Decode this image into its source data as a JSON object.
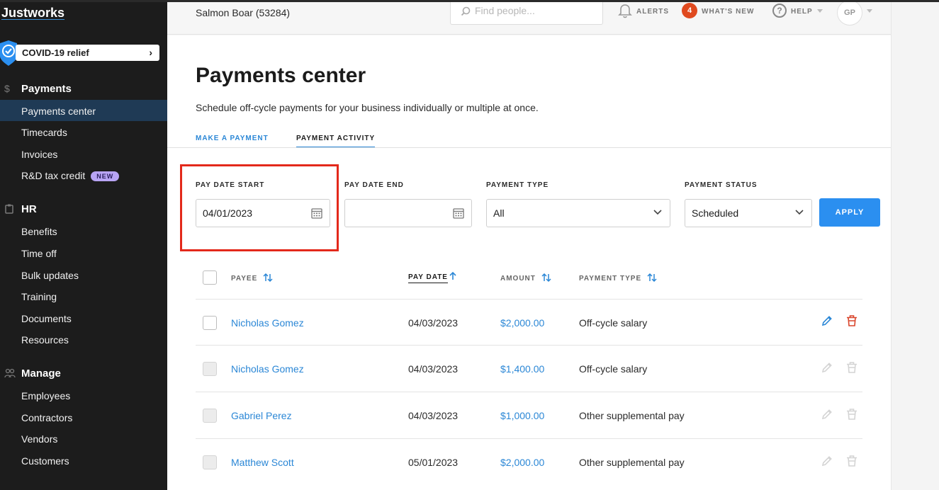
{
  "sidebar": {
    "logo": "Justworks",
    "covid_label": "COVID-19 relief",
    "sections": [
      {
        "title": "Payments",
        "items": [
          {
            "label": "Payments center"
          },
          {
            "label": "Timecards"
          },
          {
            "label": "Invoices"
          },
          {
            "label": "R&D tax credit",
            "badge": "NEW"
          }
        ]
      },
      {
        "title": "HR",
        "items": [
          {
            "label": "Benefits"
          },
          {
            "label": "Time off"
          },
          {
            "label": "Bulk updates"
          },
          {
            "label": "Training"
          },
          {
            "label": "Documents"
          },
          {
            "label": "Resources"
          }
        ]
      },
      {
        "title": "Manage",
        "items": [
          {
            "label": "Employees"
          },
          {
            "label": "Contractors"
          },
          {
            "label": "Vendors"
          },
          {
            "label": "Customers"
          }
        ]
      }
    ]
  },
  "topbar": {
    "company": "Salmon Boar (53284)",
    "search_placeholder": "Find people...",
    "alerts_label": "ALERTS",
    "notification_count": "4",
    "whats_new_label": "WHAT'S NEW",
    "help_label": "HELP",
    "avatar_initials": "GP"
  },
  "main": {
    "title": "Payments center",
    "subtitle": "Schedule off-cycle payments for your business individually or multiple at once.",
    "tabs": [
      {
        "label": "MAKE A PAYMENT",
        "active": false
      },
      {
        "label": "PAYMENT ACTIVITY",
        "active": true
      }
    ],
    "filters": {
      "pay_date_start": {
        "label": "PAY DATE START",
        "value": "04/01/2023"
      },
      "pay_date_end": {
        "label": "PAY DATE END",
        "value": ""
      },
      "payment_type": {
        "label": "PAYMENT TYPE",
        "value": "All"
      },
      "payment_status": {
        "label": "PAYMENT STATUS",
        "value": "Scheduled"
      },
      "apply_label": "APPLY"
    },
    "table": {
      "headers": [
        "PAYEE",
        "PAY DATE",
        "AMOUNT",
        "PAYMENT TYPE"
      ],
      "rows": [
        {
          "payee": "Nicholas Gomez",
          "pay_date": "04/03/2023",
          "amount": "$2,000.00",
          "type": "Off-cycle salary",
          "editable": true
        },
        {
          "payee": "Nicholas Gomez",
          "pay_date": "04/03/2023",
          "amount": "$1,400.00",
          "type": "Off-cycle salary",
          "editable": false
        },
        {
          "payee": "Gabriel Perez",
          "pay_date": "04/03/2023",
          "amount": "$1,000.00",
          "type": "Other supplemental pay",
          "editable": false
        },
        {
          "payee": "Matthew Scott",
          "pay_date": "05/01/2023",
          "amount": "$2,000.00",
          "type": "Other supplemental pay",
          "editable": false
        }
      ]
    }
  },
  "colors": {
    "accent": "#2b87d6",
    "sidebar_bg": "#1c1c1c",
    "active_nav": "#1f3a55",
    "highlight_box": "#e3291b",
    "delete_red": "#d9452b"
  }
}
